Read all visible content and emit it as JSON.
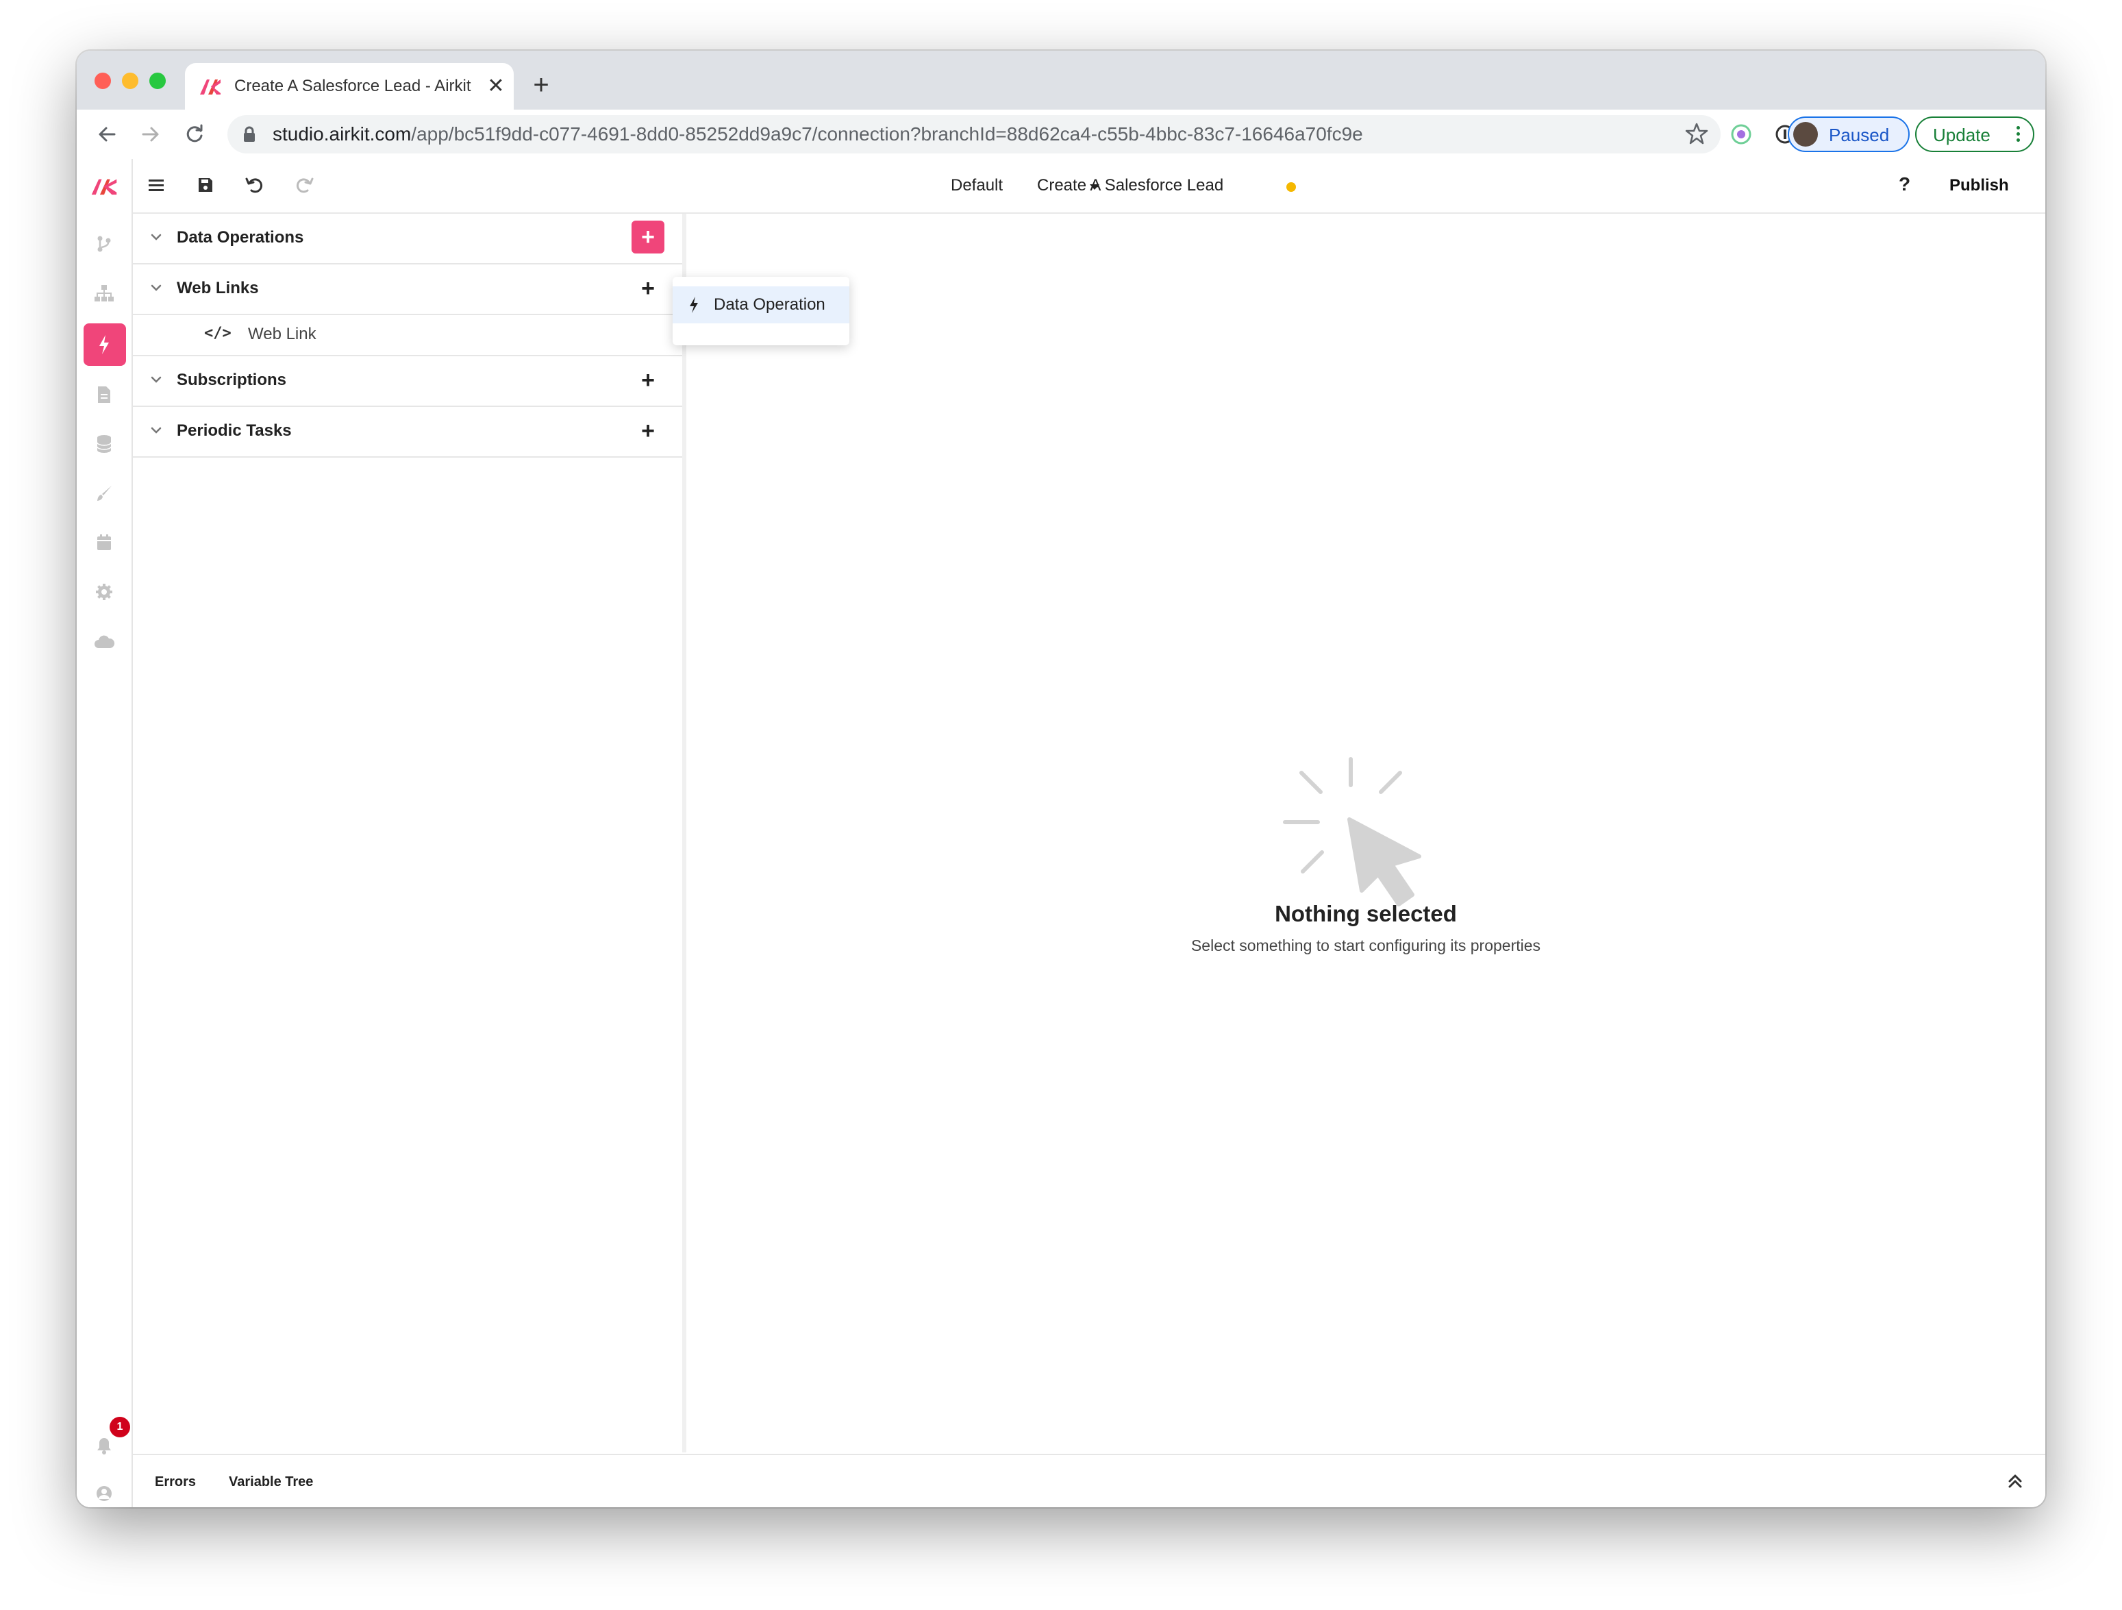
{
  "browser": {
    "tab": {
      "title": "Create A Salesforce Lead - Airkit",
      "close_glyph": "✕"
    },
    "new_tab_glyph": "+",
    "url": {
      "host": "studio.airkit.com",
      "path": "/app/bc51f9dd-c077-4691-8dd0-85252dd9a9c7/connection?branchId=88d62ca4-c55b-4bbc-83c7-16646a70fc9e"
    },
    "profile": {
      "label": "Paused"
    },
    "update_button": {
      "label": "Update"
    },
    "colors": {
      "tabstrip": "#dee1e6",
      "close": "#ff5f57",
      "minimize": "#febc2e",
      "zoom": "#28c840"
    },
    "icons": [
      "back-icon",
      "forward-icon",
      "reload-icon",
      "lock-icon",
      "star-icon",
      "extension-icon",
      "password-icon",
      "puzzle-icon",
      "more-icon"
    ]
  },
  "app": {
    "brand_color": "#f0457a",
    "toolbar": {
      "branch": "Default",
      "app_name": "Create A Salesforce Lead",
      "help": "?",
      "publish": "Publish"
    },
    "rail": {
      "icons": [
        "branch-icon",
        "sitemap-icon",
        "bolt-icon",
        "file-icon",
        "database-icon",
        "brush-icon",
        "calendar-icon",
        "settings-icon",
        "cloud-icon",
        "bell-icon",
        "user-icon"
      ],
      "active": "bolt-icon",
      "notification_count": "1"
    },
    "panel": {
      "sections": [
        {
          "title": "Data Operations",
          "add": "+"
        },
        {
          "title": "Web Links",
          "add": "+",
          "items": [
            {
              "code": "</>",
              "label": "Web Link"
            }
          ]
        },
        {
          "title": "Subscriptions",
          "add": "+"
        },
        {
          "title": "Periodic Tasks",
          "add": "+"
        }
      ]
    },
    "dropdown": {
      "item": "Data Operation"
    },
    "empty_state": {
      "title": "Nothing selected",
      "subtitle": "Select something to start configuring its properties"
    },
    "bottom": {
      "tabs": [
        "Errors",
        "Variable Tree"
      ]
    }
  }
}
